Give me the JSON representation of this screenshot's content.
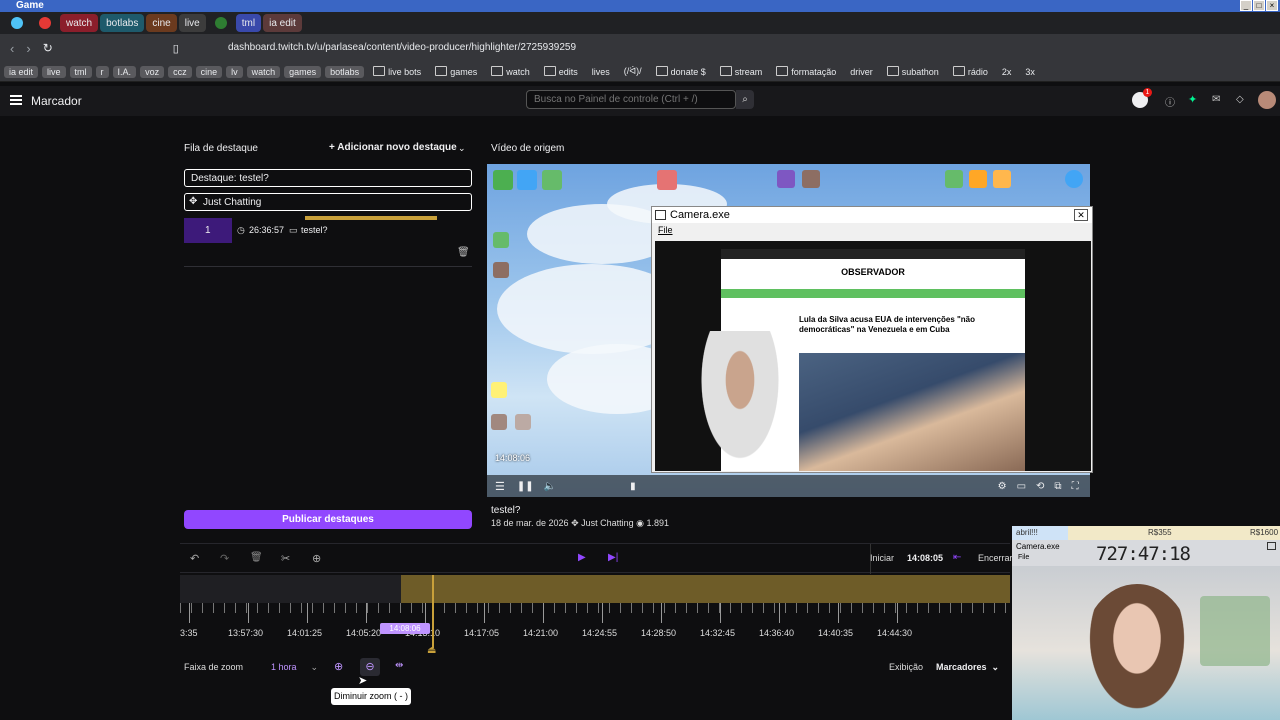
{
  "window": {
    "title": "Game"
  },
  "tabs": [
    {
      "label": "",
      "color": "#4fc3f7"
    },
    {
      "label": "",
      "color": "#e53935"
    },
    {
      "label": "watch",
      "color": "#8b1e2b"
    },
    {
      "label": "botlabs",
      "color": "#1e5a6b"
    },
    {
      "label": "cine",
      "color": "#6b3a1e"
    },
    {
      "label": "live",
      "color": "#3c3c3c"
    },
    {
      "label": "",
      "color": "#2e7d32"
    },
    {
      "label": "tml",
      "color": "#3949ab"
    },
    {
      "label": "ia edit",
      "color": "#5c3a3a"
    }
  ],
  "address": {
    "url": "dashboard.twitch.tv/u/parlasea/content/video-producer/highlighter/2725939259"
  },
  "bookmarks": [
    {
      "label": "ia edit",
      "style": "pill"
    },
    {
      "label": "live",
      "style": "pill"
    },
    {
      "label": "tml",
      "style": "pill"
    },
    {
      "label": "r",
      "style": "pill"
    },
    {
      "label": "I.A.",
      "style": "pill"
    },
    {
      "label": "voz",
      "style": "pill"
    },
    {
      "label": "ccz",
      "style": "pill"
    },
    {
      "label": "cine",
      "style": "pill"
    },
    {
      "label": "lv",
      "style": "pill"
    },
    {
      "label": "watch",
      "style": "pill"
    },
    {
      "label": "games",
      "style": "pill"
    },
    {
      "label": "botlabs",
      "style": "pill"
    },
    {
      "label": "live bots",
      "style": "folder"
    },
    {
      "label": "games",
      "style": "folder"
    },
    {
      "label": "watch",
      "style": "folder"
    },
    {
      "label": "edits",
      "style": "folder"
    },
    {
      "label": "lives",
      "style": "plain"
    },
    {
      "label": "(/ᐛ)/",
      "style": "plain"
    },
    {
      "label": "donate $",
      "style": "folder"
    },
    {
      "label": "stream",
      "style": "folder"
    },
    {
      "label": "formatação",
      "style": "folder"
    },
    {
      "label": "driver",
      "style": "plain"
    },
    {
      "label": "subathon",
      "style": "folder"
    },
    {
      "label": "rádio",
      "style": "folder"
    },
    {
      "label": "2x",
      "style": "plain"
    },
    {
      "label": "3x",
      "style": "plain"
    }
  ],
  "header": {
    "title": "Marcador",
    "search_placeholder": "Busca no Painel de controle (Ctrl + /)",
    "notification_count": "1"
  },
  "queue": {
    "title": "Fila de destaque",
    "add_label": "Adicionar novo destaque",
    "highlight_field": "Destaque: testel?",
    "category": "Just Chatting",
    "item_index": "1",
    "item_time": "26:36:57",
    "item_title": "testel?",
    "publish_label": "Publicar destaques"
  },
  "source": {
    "title": "Vídeo de origem",
    "overlay_time": "14:08:06",
    "camera_title": "Camera.exe",
    "camera_menu": "File",
    "article_brand": "OBSERVADOR",
    "article_headline": "Lula da Silva acusa EUA de intervenções \"não democráticas\" na Venezuela e em Cuba",
    "video_title": "testel?",
    "video_date": "18 de mar. de 2026",
    "video_category": "Just Chatting",
    "video_views": "1.891"
  },
  "timeline": {
    "start_label": "Iniciar",
    "start_time": "14:08:05",
    "end_label": "Encerrar",
    "playhead_time": "14:08:06",
    "ticks": [
      "3:35",
      "13:57:30",
      "14:01:25",
      "14:05:20",
      "14:13:10",
      "14:17:05",
      "14:21:00",
      "14:24:55",
      "14:28:50",
      "14:32:45",
      "14:36:40",
      "14:40:35",
      "14:44:30"
    ],
    "zoom_label": "Faixa de zoom",
    "zoom_value": "1 hora",
    "display_label": "Exibição",
    "display_value": "Marcadores",
    "tooltip": "Diminuir zoom ( - )"
  },
  "webcam": {
    "bar_left": "abril!!!",
    "bar_mid": "R$355",
    "bar_right": "R$1600",
    "title": "Camera.exe",
    "time": "727:47:18",
    "menu": "File"
  },
  "colors": {
    "accent": "#9147ff",
    "highlight_bar": "#c8a03a",
    "background": "#0e0e10"
  }
}
